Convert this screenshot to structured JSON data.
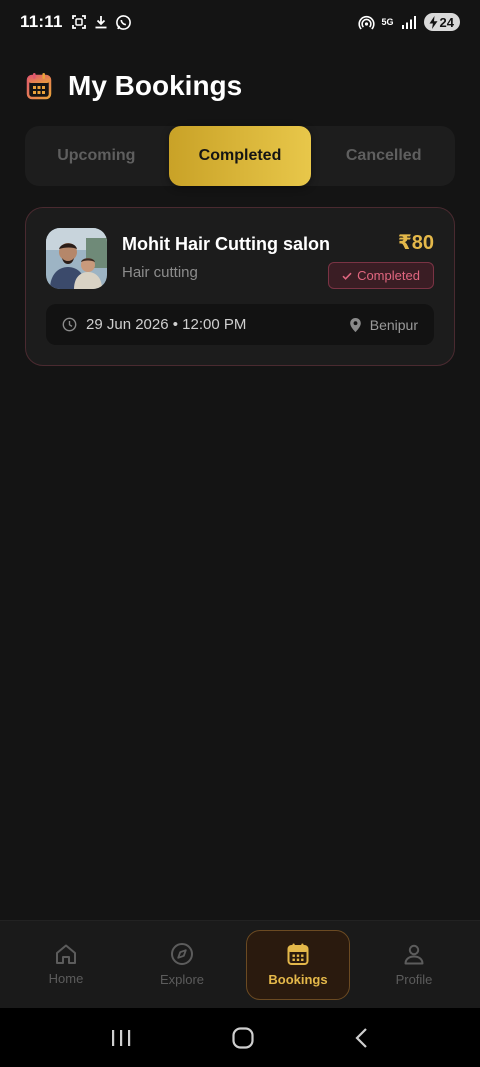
{
  "status_bar": {
    "time": "11:11",
    "battery_level": "24",
    "network": "5G",
    "icons": [
      "screenshot-icon",
      "download-icon",
      "whatsapp-icon",
      "hotspot-icon",
      "signal-icon",
      "battery-charging-icon"
    ]
  },
  "header": {
    "title": "My Bookings",
    "icon": "calendar-icon"
  },
  "tabs": [
    {
      "label": "Upcoming",
      "active": false
    },
    {
      "label": "Completed",
      "active": true
    },
    {
      "label": "Cancelled",
      "active": false
    }
  ],
  "bookings": [
    {
      "salon_name": "Mohit Hair Cutting salon",
      "service": "Hair cutting",
      "price": "₹80",
      "status": "Completed",
      "datetime": "29 Jun 2026 • 12:00 PM",
      "location": "Benipur"
    }
  ],
  "bottom_nav": [
    {
      "label": "Home",
      "icon": "home-icon",
      "active": false
    },
    {
      "label": "Explore",
      "icon": "compass-icon",
      "active": false
    },
    {
      "label": "Bookings",
      "icon": "calendar-icon",
      "active": true
    },
    {
      "label": "Profile",
      "icon": "person-icon",
      "active": false
    }
  ],
  "colors": {
    "background": "#141414",
    "accent_gold": "#e4b84a",
    "status_completed": "#e0667f"
  }
}
